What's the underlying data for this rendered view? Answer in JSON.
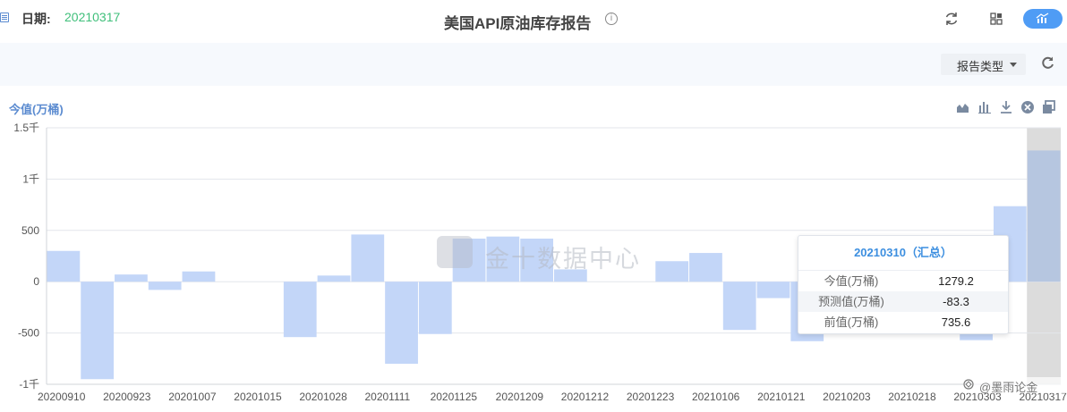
{
  "header": {
    "date_label": "日期:",
    "date_value": "20210317",
    "title": "美国API原油库存报告",
    "info_icon": "info-icon",
    "icons": [
      "refresh-icon",
      "grid-icon",
      "chart-toggle-icon"
    ]
  },
  "filter": {
    "report_type_label": "报告类型",
    "refresh_icon": "refresh-icon"
  },
  "chart_tools": [
    "area-chart-icon",
    "bar-chart-icon",
    "download-icon",
    "close-icon",
    "copy-icon"
  ],
  "watermark": "金十数据中心",
  "corner_mark": "@墨雨论金",
  "colors": {
    "bar": "#c3d6f8",
    "bar_highlight": "#b6c6e0",
    "highlight_band": "#dcdcdc",
    "accent": "#3d8fe0",
    "title_blue": "#5b8bd0"
  },
  "tooltip": {
    "title": "20210310（汇总）",
    "rows": [
      {
        "key": "今值(万桶)",
        "value": "1279.2"
      },
      {
        "key": "预测值(万桶)",
        "value": "-83.3"
      },
      {
        "key": "前值(万桶)",
        "value": "735.6"
      }
    ]
  },
  "chart_data": {
    "type": "bar",
    "ylabel": "今值(万桶)",
    "ylim": [
      -1000,
      1500
    ],
    "yticks": [
      {
        "value": 1500,
        "label": "1.5千"
      },
      {
        "value": 1000,
        "label": "1千"
      },
      {
        "value": 500,
        "label": "500"
      },
      {
        "value": 0,
        "label": "0"
      },
      {
        "value": -500,
        "label": "-500"
      },
      {
        "value": -1000,
        "label": "-1千"
      }
    ],
    "grid": true,
    "x_tick_labels": [
      "20200910",
      "20200923",
      "20201007",
      "20201015",
      "20201028",
      "20201111",
      "20201125",
      "20201209",
      "20201212",
      "20201223",
      "20210106",
      "20210121",
      "20210203",
      "20210218",
      "20210303",
      "20210317"
    ],
    "values": [
      300,
      -950,
      70,
      -80,
      100,
      0,
      0,
      -540,
      60,
      460,
      -800,
      -510,
      420,
      440,
      420,
      120,
      0,
      0,
      200,
      280,
      -470,
      -160,
      -580,
      260,
      0,
      0,
      0,
      -570,
      736,
      1279
    ],
    "highlight_index": 29,
    "highlight_label": "20210310"
  }
}
